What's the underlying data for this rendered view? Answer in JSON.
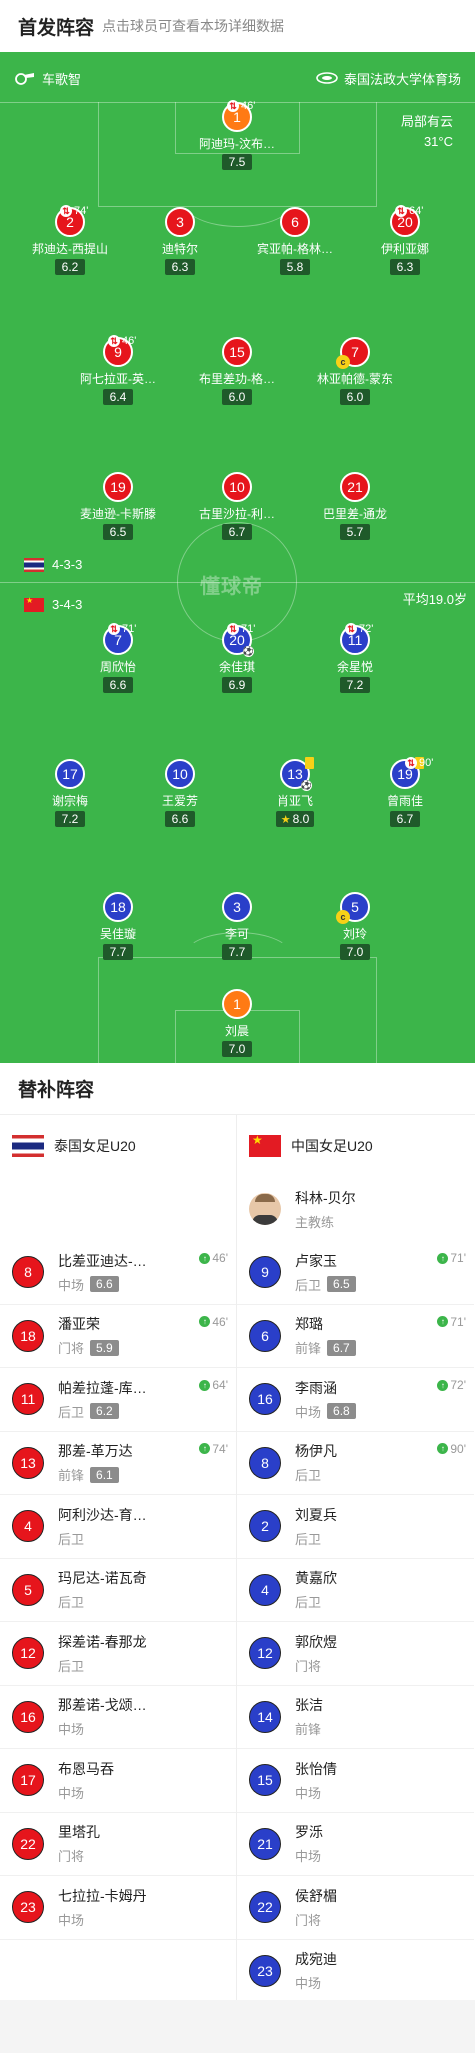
{
  "header": {
    "title": "首发阵容",
    "hint": "点击球员可查看本场详细数据"
  },
  "pitch": {
    "referee": "车歌智",
    "venue": "泰国法政大学体育场",
    "weather": "局部有云",
    "temperature": "31°C",
    "watermark": "懂球帝",
    "avg_age": "平均19.0岁",
    "home_formation": "4-3-3",
    "away_formation": "3-4-3"
  },
  "home_players": [
    {
      "num": "1",
      "name": "阿迪玛-汶布…",
      "rating": "7.5",
      "sub": "46'",
      "color": "orange"
    },
    {
      "num": "2",
      "name": "邦迪达-西提山",
      "rating": "6.2",
      "sub": "74'",
      "color": "red"
    },
    {
      "num": "3",
      "name": "迪特尔",
      "rating": "6.3",
      "color": "red"
    },
    {
      "num": "6",
      "name": "宾亚帕-格林…",
      "rating": "5.8",
      "color": "red"
    },
    {
      "num": "20",
      "name": "伊利亚娜",
      "rating": "6.3",
      "sub": "64'",
      "color": "red"
    },
    {
      "num": "9",
      "name": "阿七拉亚-英…",
      "rating": "6.4",
      "sub": "46'",
      "color": "red"
    },
    {
      "num": "15",
      "name": "布里差功-格…",
      "rating": "6.0",
      "color": "red"
    },
    {
      "num": "7",
      "name": "林亚帕德-蒙东",
      "rating": "6.0",
      "color": "red",
      "captain": "c"
    },
    {
      "num": "19",
      "name": "麦迪逊-卡斯滕",
      "rating": "6.5",
      "color": "red"
    },
    {
      "num": "10",
      "name": "古里沙拉-利…",
      "rating": "6.7",
      "color": "red"
    },
    {
      "num": "21",
      "name": "巴里差-通龙",
      "rating": "5.7",
      "color": "red"
    }
  ],
  "away_players": [
    {
      "num": "7",
      "name": "周欣怡",
      "rating": "6.6",
      "sub": "71'",
      "color": "blue"
    },
    {
      "num": "20",
      "name": "余佳琪",
      "rating": "6.9",
      "sub": "71'",
      "color": "blue"
    },
    {
      "num": "11",
      "name": "余星悦",
      "rating": "7.2",
      "sub": "72'",
      "color": "blue"
    },
    {
      "num": "17",
      "name": "谢宗梅",
      "rating": "7.2",
      "color": "blue"
    },
    {
      "num": "10",
      "name": "王爱芳",
      "rating": "6.6",
      "color": "blue"
    },
    {
      "num": "13",
      "name": "肖亚飞",
      "rating": "8.0",
      "color": "blue",
      "star": "★"
    },
    {
      "num": "19",
      "name": "曾雨佳",
      "rating": "6.7",
      "sub": "90'",
      "color": "blue"
    },
    {
      "num": "18",
      "name": "吴佳璇",
      "rating": "7.7",
      "color": "blue"
    },
    {
      "num": "3",
      "name": "李可",
      "rating": "7.7",
      "color": "blue"
    },
    {
      "num": "5",
      "name": "刘玲",
      "rating": "7.0",
      "color": "blue",
      "captain": "c"
    },
    {
      "num": "1",
      "name": "刘晨",
      "rating": "7.0",
      "color": "orange"
    }
  ],
  "subs": {
    "title": "替补阵容",
    "home_team": "泰国女足U20",
    "away_team": "中国女足U20",
    "coach_name": "科林-贝尔",
    "coach_role": "主教练",
    "home": [
      {
        "num": "8",
        "name": "比差亚迪达-…",
        "pos": "中场",
        "rating": "6.6",
        "min": "46'"
      },
      {
        "num": "18",
        "name": "潘亚荣",
        "pos": "门将",
        "rating": "5.9",
        "min": "46'"
      },
      {
        "num": "11",
        "name": "帕差拉蓬-库…",
        "pos": "后卫",
        "rating": "6.2",
        "min": "64'"
      },
      {
        "num": "13",
        "name": "那差-革万达",
        "pos": "前锋",
        "rating": "6.1",
        "min": "74'"
      },
      {
        "num": "4",
        "name": "阿利沙达-育…",
        "pos": "后卫"
      },
      {
        "num": "5",
        "name": "玛尼达-诺瓦奇",
        "pos": "后卫"
      },
      {
        "num": "12",
        "name": "探差诺-春那龙",
        "pos": "后卫"
      },
      {
        "num": "16",
        "name": "那差诺-戈颂…",
        "pos": "中场"
      },
      {
        "num": "17",
        "name": "布恩马吞",
        "pos": "中场"
      },
      {
        "num": "22",
        "name": "里塔孔",
        "pos": "门将"
      },
      {
        "num": "23",
        "name": "七拉拉-卡姆丹",
        "pos": "中场"
      }
    ],
    "away": [
      {
        "num": "9",
        "name": "卢家玉",
        "pos": "后卫",
        "rating": "6.5",
        "min": "71'"
      },
      {
        "num": "6",
        "name": "郑璐",
        "pos": "前锋",
        "rating": "6.7",
        "min": "71'"
      },
      {
        "num": "16",
        "name": "李雨涵",
        "pos": "中场",
        "rating": "6.8",
        "min": "72'"
      },
      {
        "num": "8",
        "name": "杨伊凡",
        "pos": "后卫",
        "min": "90'"
      },
      {
        "num": "2",
        "name": "刘夏兵",
        "pos": "后卫"
      },
      {
        "num": "4",
        "name": "黄嘉欣",
        "pos": "后卫"
      },
      {
        "num": "12",
        "name": "郭欣煜",
        "pos": "门将"
      },
      {
        "num": "14",
        "name": "张洁",
        "pos": "前锋"
      },
      {
        "num": "15",
        "name": "张怡倩",
        "pos": "中场"
      },
      {
        "num": "21",
        "name": "罗泺",
        "pos": "中场"
      },
      {
        "num": "22",
        "name": "侯舒楣",
        "pos": "门将"
      },
      {
        "num": "23",
        "name": "成宛迪",
        "pos": "中场"
      }
    ]
  },
  "colors": {
    "pitch": "#3cb54a",
    "home": "#e6151c",
    "away": "#2a3fc9",
    "keeper": "#ff7a14",
    "yellow_card": "#f7d117"
  },
  "icons": [
    "whistle-icon",
    "stadium-icon",
    "substitution-out-icon",
    "substitution-in-icon",
    "yellow-card-icon",
    "goal-ball-icon",
    "captain-icon",
    "star-icon"
  ]
}
